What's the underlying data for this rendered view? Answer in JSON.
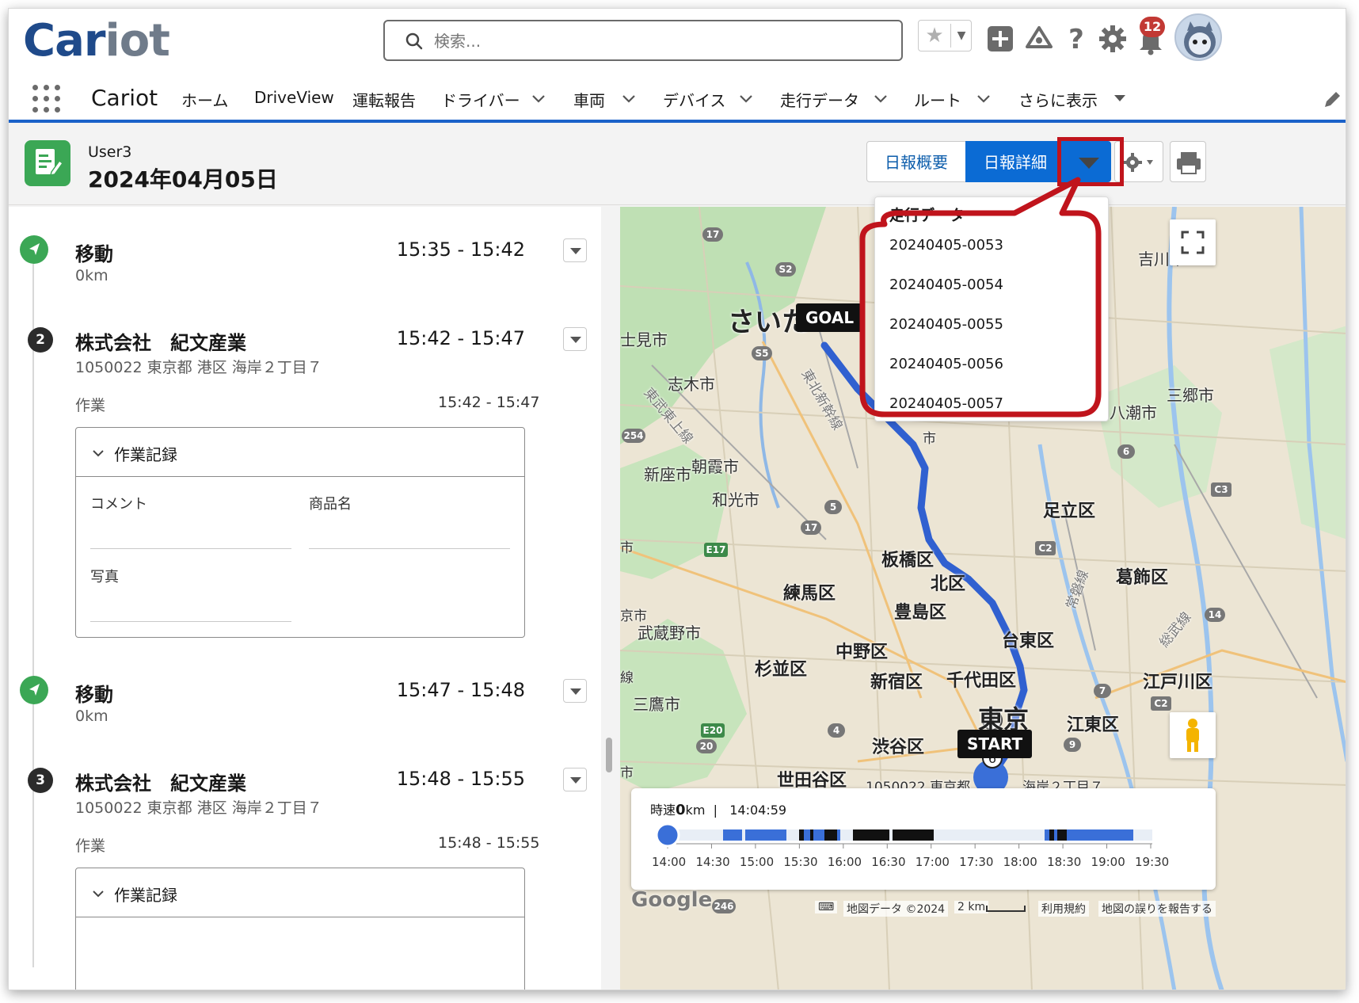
{
  "app": {
    "logo_part1": "Car",
    "logo_part2": "iot",
    "name": "Cariot"
  },
  "search": {
    "placeholder": "検索..."
  },
  "header_icons": {
    "notification_count": "12"
  },
  "nav": {
    "items": [
      {
        "label": "ホーム",
        "has_caret": false
      },
      {
        "label": "DriveView",
        "has_caret": false
      },
      {
        "label": "運転報告",
        "has_caret": false
      },
      {
        "label": "ドライバー",
        "has_caret": true
      },
      {
        "label": "車両",
        "has_caret": true
      },
      {
        "label": "デバイス",
        "has_caret": true
      },
      {
        "label": "走行データ",
        "has_caret": true
      },
      {
        "label": "ルート",
        "has_caret": true
      },
      {
        "label": "さらに表示",
        "has_caret": true
      }
    ]
  },
  "record": {
    "subtitle": "User3",
    "title": "2024年04月05日",
    "buttons": {
      "summary": "日報概要",
      "detail": "日報詳細"
    }
  },
  "dropdown": {
    "header": "走行データ",
    "items": [
      "20240405-0053",
      "20240405-0054",
      "20240405-0055",
      "20240405-0056",
      "20240405-0057"
    ]
  },
  "events": [
    {
      "title": "移動",
      "time": "15:35 - 15:42",
      "distance": "0km"
    },
    {
      "number": "2",
      "title": "株式会社　紀文産業",
      "time": "15:42 - 15:47",
      "address": "1050022 東京都 港区 海岸２丁目７",
      "task_label": "作業",
      "task_time": "15:42 - 15:47",
      "card": {
        "title": "作業記録",
        "fields": {
          "comment": "コメント",
          "product": "商品名",
          "photo": "写真"
        }
      }
    },
    {
      "title": "移動",
      "time": "15:47 - 15:48",
      "distance": "0km"
    },
    {
      "number": "3",
      "title": "株式会社　紀文産業",
      "time": "15:48 - 15:55",
      "address": "1050022 東京都 港区 海岸２丁目７",
      "task_label": "作業",
      "task_time": "15:48 - 15:55",
      "card": {
        "title": "作業記録"
      }
    }
  ],
  "map": {
    "labels": {
      "saitama": "さいた",
      "fujimi": "士見市",
      "shiki": "志木市",
      "asaka": "朝霞市",
      "niiza": "新座市",
      "wako": "和光市",
      "adachi": "足立区",
      "itabashi": "板橋区",
      "kita": "北区",
      "nerima": "練馬区",
      "toshima": "豊島区",
      "katsushika": "葛飾区",
      "musashino": "武蔵野市",
      "nakano": "中野区",
      "taito": "台東区",
      "suginami": "杉並区",
      "shinjuku": "新宿区",
      "chiyoda": "千代田区",
      "edogawa": "江戸川区",
      "mitaka": "三鷹市",
      "tokyo": "東京",
      "koto": "江東区",
      "shibuya": "渋谷区",
      "setagaya": "世田谷区",
      "misato": "三郷市",
      "yashio": "八潮市",
      "yoshikawa": "吉川市",
      "shi1": "市",
      "kyoshi": "京市",
      "fushi": "市",
      "sen": "線",
      "sanshi": "市",
      "address_frag": "1050022 東京都",
      "address_frag2": "海岸２丁目７",
      "tobu": "東武東上線",
      "tohoku": "東北新幹線",
      "jobanline": "常磐線",
      "sobu": "総武線"
    },
    "goal_label": "GOAL",
    "start_label": "START",
    "speed_prefix": "時速",
    "speed_value": "0",
    "speed_unit": "km",
    "speed_sep": "|",
    "current_time": "14:04:59",
    "ticks": [
      "14:00",
      "14:30",
      "15:00",
      "15:30",
      "16:00",
      "16:30",
      "17:00",
      "17:30",
      "18:00",
      "18:30",
      "19:00",
      "19:30"
    ],
    "scrubber_position": 0,
    "footer": {
      "attribution": "地図データ ©2024",
      "scale": "2 km",
      "terms": "利用規約",
      "report": "地図の誤りを報告する",
      "google": "Google"
    },
    "road_badges": [
      "17",
      "S2",
      "S5",
      "254",
      "5",
      "17",
      "E17",
      "C2",
      "C3",
      "6",
      "7",
      "14",
      "C2",
      "4",
      "E20",
      "20",
      "9",
      "246"
    ]
  },
  "colors": {
    "brand_blue": "#1f4a8a",
    "nav_underline": "#1b62c9",
    "selected_button": "#0b6bd4",
    "success_green": "#3ba755",
    "highlight_red": "#c0141c",
    "route_blue": "#3060d0",
    "badge_red": "#c23934"
  },
  "icons": [
    "search-icon",
    "star-icon",
    "add-icon",
    "trailhead-icon",
    "help-icon",
    "settings-icon",
    "bell-icon",
    "waffle-icon",
    "pencil-icon",
    "report-icon",
    "chevron-down-icon",
    "gear-icon",
    "print-icon",
    "navigation-icon",
    "fullscreen-icon",
    "pegman-icon"
  ]
}
